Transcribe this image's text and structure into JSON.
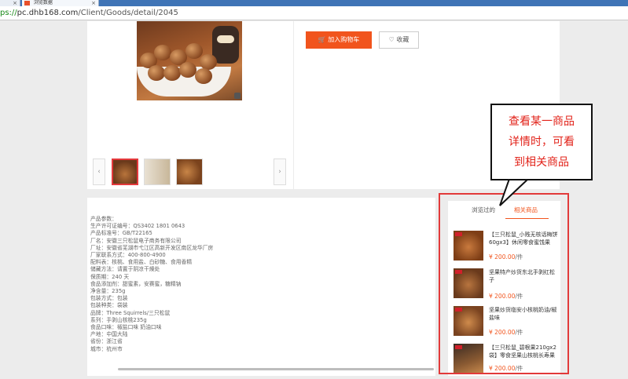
{
  "browser": {
    "tabs": [
      {
        "label": "",
        "close": "×"
      },
      {
        "label": "浏览数据",
        "close": "×"
      }
    ],
    "url_scheme": "ps://",
    "url_host": "pc.dhb168.com",
    "url_path": "/Client/Goods/detail/2045"
  },
  "product": {
    "add_to_cart": "加入购物车",
    "favorite": "收藏",
    "thumb_prev": "‹",
    "thumb_next": "›"
  },
  "params": [
    "产品参数：",
    "生产许可证编号：QS3402 1801 0643",
    "产品标准号：GB/T22165",
    "厂名：安徽三只松鼠电子商务有限公司",
    "厂址：安徽省芜湖市弋江区高新开发区南区龙华厂房",
    "厂家联系方式：400-800-4900",
    "配料表：核桃、食用盐、白砂糖、食用香精",
    "储藏方法：请置于阴凉干燥处",
    "保质期：240 天",
    "食品添加剂：甜蜜素，安赛蜜，糖精钠",
    "净含量：235g",
    "包装方式：包装",
    "包装种类：袋装",
    "品牌：Three Squirrels/三只松鼠",
    "系列：手剥山核桃235g",
    "食品口味：椒盐口味 奶油口味",
    "产地：中国大陆",
    "省份：浙江省",
    "城市：杭州市"
  ],
  "side": {
    "tab_viewed": "浏览过的",
    "tab_related": "相关商品",
    "items": [
      {
        "title": "【三只松鼠_小贱无核话梅饼60gx3】休闲零食蜜饯果",
        "price": "¥ 200.00",
        "unit": "/件"
      },
      {
        "title": "坚果特产炒货东北手剥红松子",
        "price": "¥ 200.00",
        "unit": "/件"
      },
      {
        "title": "坚果炒货临安小核桃奶油/椒盐味",
        "price": "¥ 200.00",
        "unit": "/件"
      },
      {
        "title": "【三只松鼠_碧根果210gx2袋】零食坚果山核桃长寿果",
        "price": "¥ 200.00",
        "unit": "/件"
      }
    ]
  },
  "annotation": {
    "lines": [
      "查看某一商品",
      "详情时，可看",
      "到相关商品"
    ]
  },
  "colors": {
    "accent": "#f1541d",
    "annotation_red": "#e2231a"
  }
}
